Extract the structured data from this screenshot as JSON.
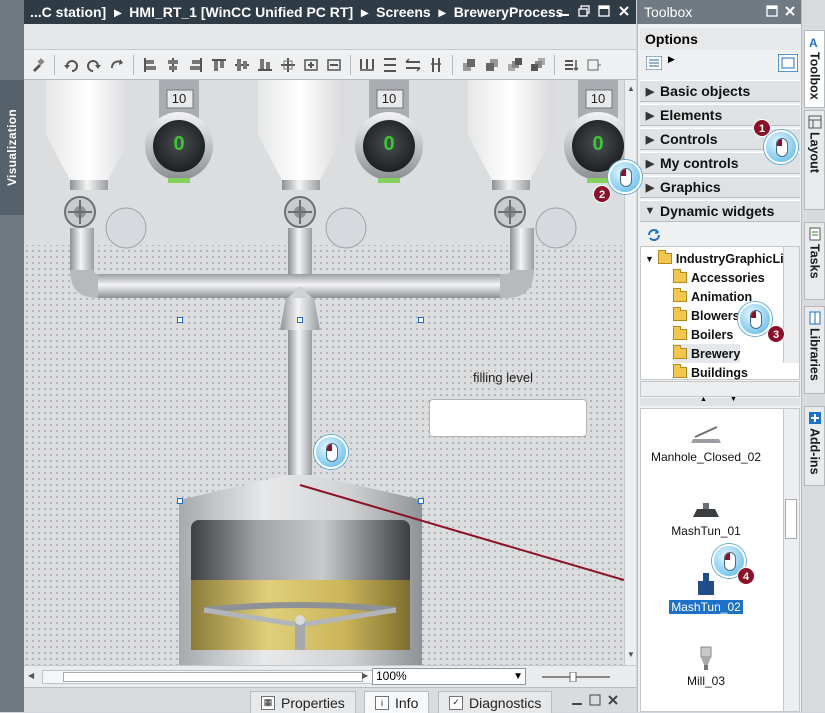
{
  "titlebar": {
    "crumbs": [
      "...C station]",
      "HMI_RT_1 [WinCC Unified PC RT]",
      "Screens",
      "BreweryProcess"
    ],
    "separator": "▸"
  },
  "left_tab": {
    "label": "Visualization"
  },
  "canvas": {
    "gauges": [
      {
        "top_value": "10",
        "value": "0"
      },
      {
        "top_value": "10",
        "value": "0"
      },
      {
        "top_value": "10",
        "value": "0"
      }
    ],
    "filling_label": "filling level",
    "zoom": "100%"
  },
  "bottom_tabs": [
    {
      "label": "Properties"
    },
    {
      "label": "Info"
    },
    {
      "label": "Diagnostics"
    }
  ],
  "toolbox": {
    "title": "Toolbox",
    "options_label": "Options",
    "sections": [
      {
        "label": "Basic objects",
        "expanded": false
      },
      {
        "label": "Elements",
        "expanded": false
      },
      {
        "label": "Controls",
        "expanded": false
      },
      {
        "label": "My controls",
        "expanded": false
      },
      {
        "label": "Graphics",
        "expanded": false
      },
      {
        "label": "Dynamic widgets",
        "expanded": true
      }
    ],
    "tree_root": "IndustryGraphicLi...",
    "tree_items": [
      {
        "label": "Accessories"
      },
      {
        "label": "Animation"
      },
      {
        "label": "Blowers"
      },
      {
        "label": "Boilers"
      },
      {
        "label": "Brewery"
      },
      {
        "label": "Buildings"
      }
    ],
    "library_items": [
      {
        "label": "Manhole_Closed_02",
        "selected": false
      },
      {
        "label": "MashTun_01",
        "selected": false
      },
      {
        "label": "MashTun_02",
        "selected": true
      },
      {
        "label": "Mill_03",
        "selected": false
      }
    ]
  },
  "right_tabs": [
    {
      "label": "Toolbox",
      "active": true
    },
    {
      "label": "Layout",
      "active": false
    },
    {
      "label": "Tasks",
      "active": false
    },
    {
      "label": "Libraries",
      "active": false
    },
    {
      "label": "Add-ins",
      "active": false
    }
  ],
  "callouts": [
    "1",
    "2",
    "3",
    "4"
  ],
  "colors": {
    "accent": "#1d72c7",
    "titlebar": "#2f3b45",
    "badge": "#8a1127",
    "gauge_value": "#39c734"
  }
}
